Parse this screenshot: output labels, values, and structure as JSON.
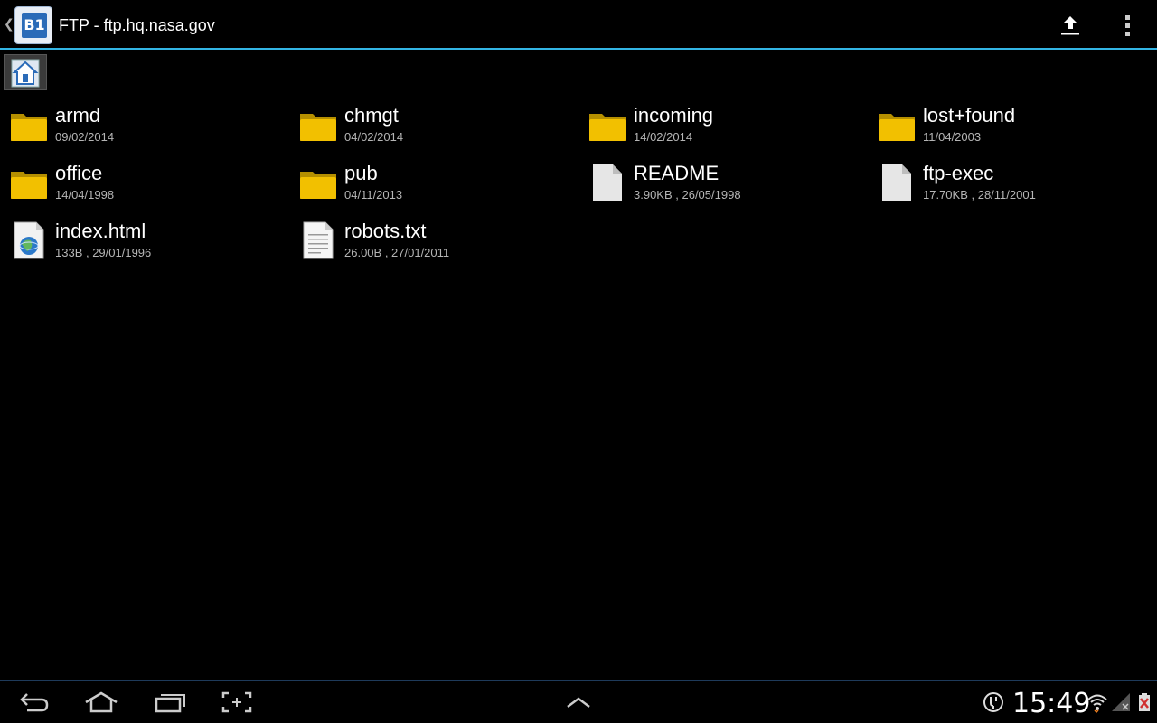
{
  "actionbar": {
    "title": "FTP - ftp.hq.nasa.gov",
    "app_icon_text": "B1"
  },
  "files": [
    {
      "name": "armd",
      "meta": "09/02/2014",
      "kind": "folder"
    },
    {
      "name": "chmgt",
      "meta": "04/02/2014",
      "kind": "folder"
    },
    {
      "name": "incoming",
      "meta": "14/02/2014",
      "kind": "folder"
    },
    {
      "name": "lost+found",
      "meta": "11/04/2003",
      "kind": "folder"
    },
    {
      "name": "office",
      "meta": "14/04/1998",
      "kind": "folder"
    },
    {
      "name": "pub",
      "meta": "04/11/2013",
      "kind": "folder"
    },
    {
      "name": "README",
      "meta": "3.90KB , 26/05/1998",
      "kind": "file"
    },
    {
      "name": "ftp-exec",
      "meta": "17.70KB , 28/11/2001",
      "kind": "file"
    },
    {
      "name": "index.html",
      "meta": "133B , 29/01/1996",
      "kind": "html"
    },
    {
      "name": "robots.txt",
      "meta": "26.00B , 27/01/2011",
      "kind": "text"
    }
  ],
  "statusbar": {
    "time": "15:49"
  },
  "colors": {
    "accent": "#33b5e5",
    "folder": "#f2c000"
  }
}
